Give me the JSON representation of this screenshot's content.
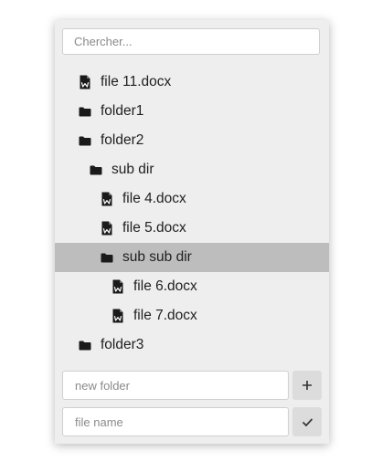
{
  "search": {
    "placeholder": "Chercher..."
  },
  "tree": [
    {
      "label": "file 11.docx",
      "icon": "word-file-icon",
      "level": 0,
      "selected": false
    },
    {
      "label": "folder1",
      "icon": "folder-icon",
      "level": 0,
      "selected": false
    },
    {
      "label": "folder2",
      "icon": "folder-icon",
      "level": 0,
      "selected": false
    },
    {
      "label": "sub dir",
      "icon": "folder-icon",
      "level": 1,
      "selected": false
    },
    {
      "label": "file 4.docx",
      "icon": "word-file-icon",
      "level": 2,
      "selected": false
    },
    {
      "label": "file 5.docx",
      "icon": "word-file-icon",
      "level": 2,
      "selected": false
    },
    {
      "label": "sub sub dir",
      "icon": "folder-icon",
      "level": 2,
      "selected": true
    },
    {
      "label": "file 6.docx",
      "icon": "word-file-icon",
      "level": 3,
      "selected": false
    },
    {
      "label": "file 7.docx",
      "icon": "word-file-icon",
      "level": 3,
      "selected": false
    },
    {
      "label": "folder3",
      "icon": "folder-icon",
      "level": 0,
      "selected": false
    }
  ],
  "new_folder": {
    "placeholder": "new folder",
    "button_icon": "plus-icon"
  },
  "file_name": {
    "placeholder": "file name",
    "button_icon": "check-icon"
  },
  "colors": {
    "panel_bg": "#eeeeee",
    "selected_bg": "#bdbdbd",
    "button_bg": "#dcdcdc",
    "text": "#1f1f1f"
  }
}
